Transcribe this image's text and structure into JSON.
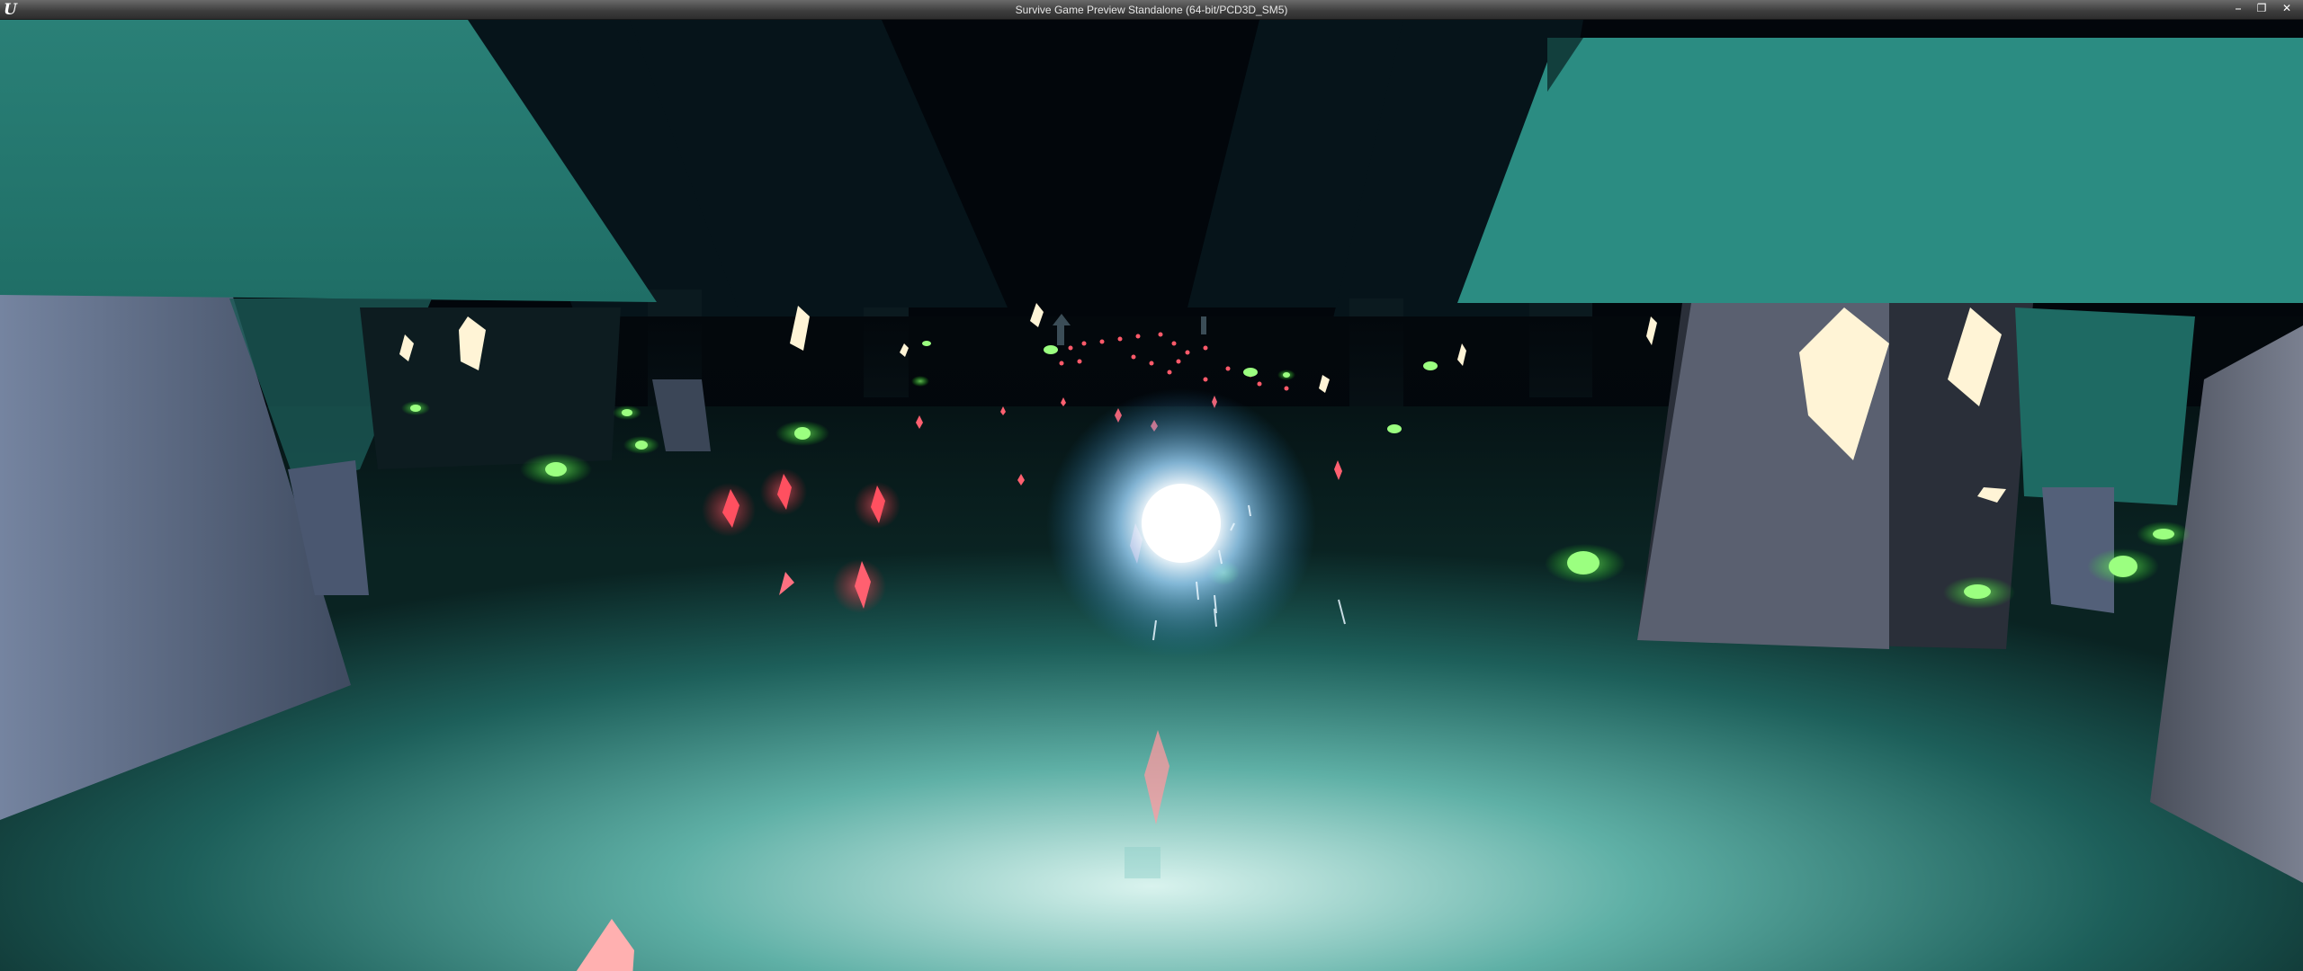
{
  "window": {
    "title": "Survive Game Preview Standalone (64-bit/PCD3D_SM5)",
    "logo": "unreal-engine-logo",
    "buttons": {
      "minimize": "minimize-icon",
      "restore": "restore-icon",
      "close": "close-icon"
    }
  },
  "scene": {
    "description_type": "3d-game-viewport",
    "colors": {
      "sky": "#02060b",
      "ground": "#1f6b66",
      "tree_canopy": "#2a8a80",
      "tree_trunk": "#5d6e85",
      "player_glow": "#bfe6ff",
      "red_crystal": "#ff4a5a",
      "green_orb": "#6cff5a",
      "lantern": "#fff4d6"
    }
  }
}
